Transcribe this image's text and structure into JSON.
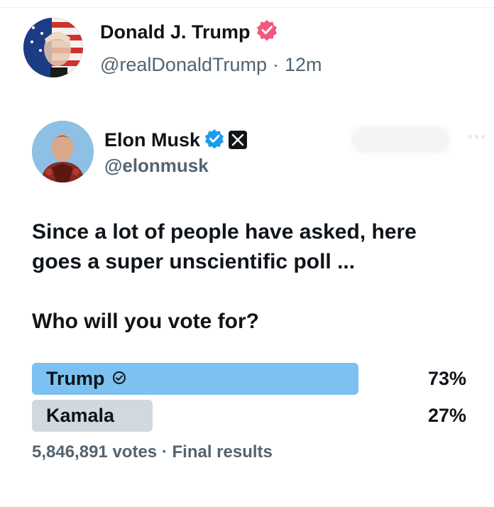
{
  "outer_post": {
    "author_name": "Donald J. Trump",
    "handle": "@realDonaldTrump",
    "separator": "·",
    "time": "12m",
    "badge_color": "#f0587c"
  },
  "quoted_post": {
    "author_name": "Elon Musk",
    "handle": "@elonmusk",
    "badge_color": "#1d9bf0",
    "affiliate_badge": "X",
    "text": "Since a lot of people have asked, here goes a super unscientific poll ...",
    "question": "Who will you vote for?"
  },
  "poll": {
    "options": [
      {
        "label": "Trump",
        "percent_text": "73%",
        "percent": 73,
        "selected": true,
        "color": "#7cc1f2"
      },
      {
        "label": "Kamala",
        "percent_text": "27%",
        "percent": 27,
        "selected": false,
        "color": "#cfd9df"
      }
    ],
    "votes": "5,846,891 votes",
    "separator": "·",
    "status": "Final results"
  }
}
